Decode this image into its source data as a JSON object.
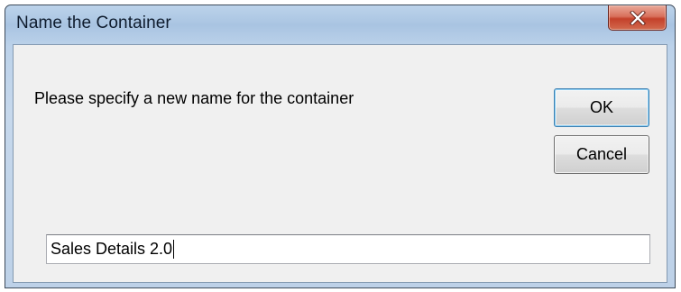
{
  "dialog": {
    "title": "Name the Container",
    "prompt": "Please specify a new name for the container",
    "ok_label": "OK",
    "cancel_label": "Cancel",
    "name_input": {
      "value": "Sales Details 2.0"
    }
  },
  "icons": {
    "close": "close-x-icon"
  },
  "colors": {
    "titlebar": "#bcd3ea",
    "close_button": "#c4412a",
    "client_area": "#f0f0f0"
  }
}
